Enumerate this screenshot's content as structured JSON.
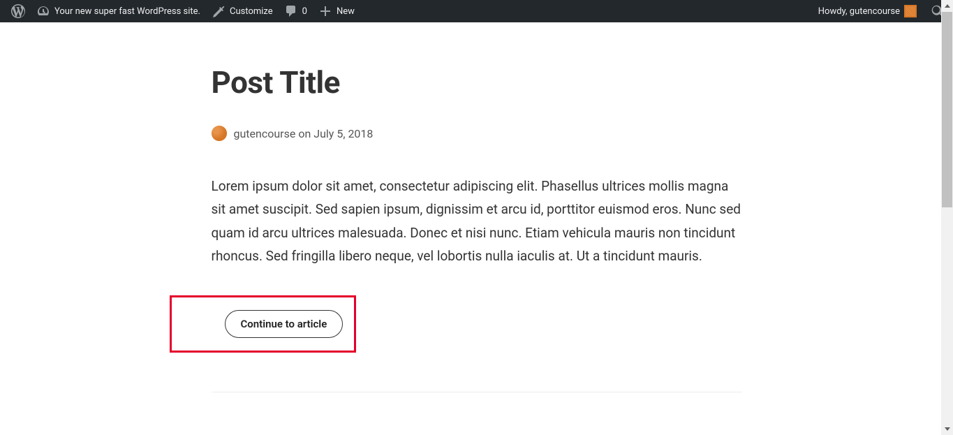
{
  "adminBar": {
    "siteName": "Your new super fast WordPress site.",
    "customize": "Customize",
    "commentsCount": "0",
    "new": "New",
    "howdy": "Howdy, gutencourse"
  },
  "post": {
    "title": "Post Title",
    "author": "gutencourse",
    "on": "on",
    "date": "July 5, 2018",
    "excerpt": "Lorem ipsum dolor sit amet, consectetur adipiscing elit. Phasellus ultrices mollis magna sit amet suscipit. Sed sapien ipsum, dignissim et arcu id, porttitor euismod eros. Nunc sed quam id arcu ultrices malesuada. Donec et nisi nunc. Etiam vehicula mauris non tincidunt rhoncus. Sed fringilla libero neque, vel lobortis nulla iaculis at. Ut a tincidunt mauris.",
    "continueLabel": "Continue to article"
  }
}
